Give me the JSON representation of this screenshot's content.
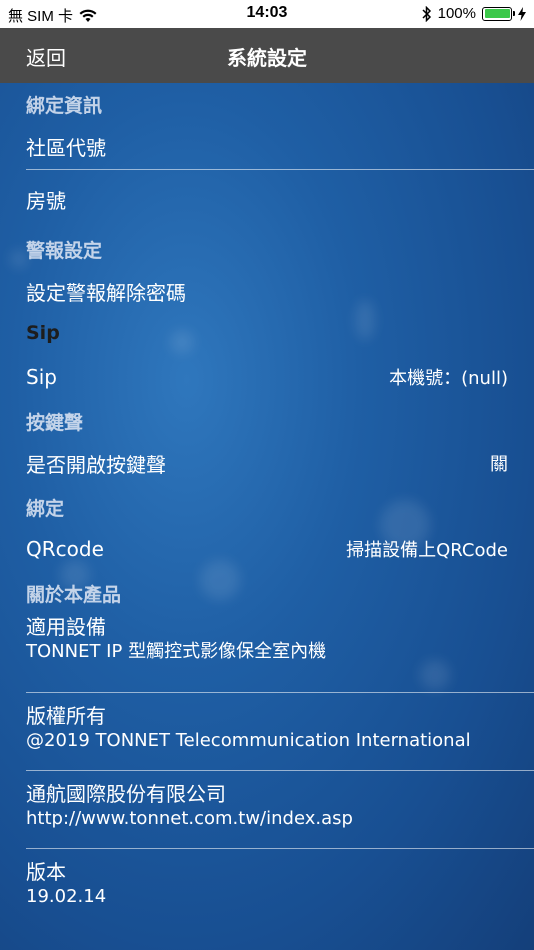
{
  "status_bar": {
    "carrier": "無 SIM 卡",
    "time": "14:03",
    "battery_percent": "100%",
    "battery_level": 1.0
  },
  "nav": {
    "back_label": "返回",
    "title": "系統設定"
  },
  "sections": {
    "binding_info": {
      "header": "綁定資訊",
      "community_code": "社區代號",
      "room_number": "房號"
    },
    "alarm": {
      "header": "警報設定",
      "alarm_password": "設定警報解除密碼"
    },
    "sip": {
      "header": "Sip",
      "sip_label": "Sip",
      "sip_value": "本機號：(null)"
    },
    "keytone": {
      "header": "按鍵聲",
      "keytone_label": "是否開啟按鍵聲",
      "keytone_value": "關"
    },
    "bind": {
      "header": "綁定",
      "qrcode_label": "QRcode",
      "qrcode_value": "掃描設備上QRCode"
    },
    "about": {
      "header": "關於本產品",
      "items": [
        {
          "title": "適用設備",
          "detail": "TONNET IP 型觸控式影像保全室內機"
        },
        {
          "title": "版權所有",
          "detail": "@2019 TONNET Telecommunication International"
        },
        {
          "title": "通航國際股份有限公司",
          "detail": "http://www.tonnet.com.tw/index.asp"
        },
        {
          "title": "版本",
          "detail": "19.02.14"
        }
      ]
    }
  },
  "colors": {
    "background": "#1f5fa5",
    "navbar": "#4a4a4a",
    "battery_fill": "#3cc84a"
  }
}
